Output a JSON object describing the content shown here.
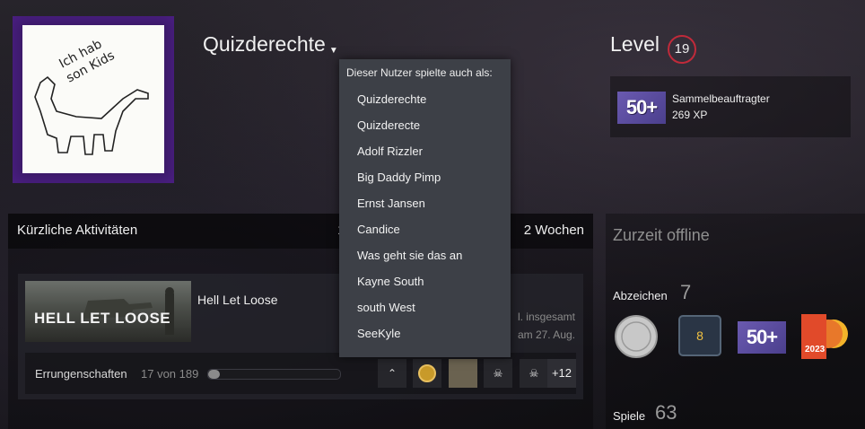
{
  "profile": {
    "persona_name": "Quizderechte",
    "level_label": "Level",
    "level_value": "19"
  },
  "featured_badge": {
    "image_text": "50+",
    "title": "Sammelbeauftragter",
    "xp": "269 XP"
  },
  "aliases_dropdown": {
    "header": "Dieser Nutzer spielte auch als:",
    "items": [
      "Quizderechte",
      "Quizderecte",
      "Adolf Rizzler",
      "Big Daddy Pimp",
      "Ernst Jansen",
      "Candice",
      "Was geht sie das an",
      "Kayne South",
      "south West",
      "SeeKyle"
    ]
  },
  "recent_activity": {
    "title": "Kürzliche Aktivitäten",
    "hours_prefix": "1",
    "hours_suffix": "2 Wochen",
    "game": {
      "name": "Hell Let Loose",
      "capsule_logo": "HELL LET LOOSE",
      "meta_line1": "l. insgesamt",
      "meta_line2": "am 27. Aug.",
      "achievements_label": "Errungenschaften",
      "achievements_count": "17 von 189",
      "achievements_progress": 0.09,
      "more_achievements": "+12"
    }
  },
  "sidebar": {
    "status": "Zurzeit offline",
    "badges_label": "Abzeichen",
    "badges_count": "7",
    "badge_50_text": "50+",
    "badge_steam_year": "2023",
    "badge_eight_text": "8",
    "games_label": "Spiele",
    "games_count": "63"
  },
  "colors": {
    "level_ring": "#c02a3a",
    "dropdown_bg": "#3d4047",
    "avatar_border": "#3a1a66",
    "badge_purple": "#6a5ab0",
    "steam_badge_orange": "#e8782a"
  }
}
